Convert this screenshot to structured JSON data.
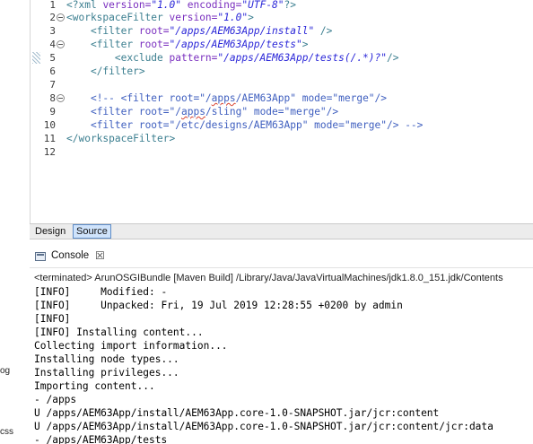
{
  "left_strip": {
    "fragment_1": "og",
    "fragment_2": "css"
  },
  "editor": {
    "lines": [
      {
        "num": "1"
      },
      {
        "num": "2"
      },
      {
        "num": "3"
      },
      {
        "num": "4"
      },
      {
        "num": "5"
      },
      {
        "num": "6"
      },
      {
        "num": "7"
      },
      {
        "num": "8"
      },
      {
        "num": "9"
      },
      {
        "num": "10"
      },
      {
        "num": "11"
      },
      {
        "num": "12"
      }
    ],
    "l1": {
      "a": "<?",
      "b": "xml",
      "c": " version=",
      "d": "\"1.0\"",
      "e": " encoding=",
      "f": "\"UTF-8\"",
      "g": "?>"
    },
    "l2": {
      "a": "<workspaceFilter",
      "b": " version=",
      "c": "\"1.0\"",
      "d": ">"
    },
    "l3": {
      "indent": "    ",
      "a": "<filter",
      "b": " root=",
      "c": "\"/apps/AEM63App/install\"",
      "d": " />"
    },
    "l4": {
      "indent": "    ",
      "a": "<filter",
      "b": " root=",
      "c": "\"/apps/AEM63App/tests\"",
      "d": ">"
    },
    "l5": {
      "indent": "        ",
      "a": "<exclude",
      "b": " pattern=",
      "c": "\"/apps/AEM63App/tests(/.*)?\"",
      "d": "/>"
    },
    "l6": {
      "indent": "    ",
      "a": "</filter>"
    },
    "l8": {
      "indent": "    ",
      "a": "<!-- <filter root=\"/",
      "b": "apps",
      "c": "/AEM63App\" mode=\"merge\"/>"
    },
    "l9": {
      "indent": "    ",
      "a": "<filter root=\"/",
      "b": "apps",
      "c": "/sling\" mode=\"merge\"/>"
    },
    "l10": {
      "indent": "    ",
      "a": "<filter root=\"/etc/designs/AEM63App\" mode=\"merge\"/> -->"
    },
    "l11": {
      "a": "</workspaceFilter>"
    }
  },
  "tabs": {
    "design": "Design",
    "source": "Source"
  },
  "console": {
    "title": "Console",
    "close": "☒",
    "terminated": "<terminated> ArunOSGIBundle [Maven Build] /Library/Java/JavaVirtualMachines/jdk1.8.0_151.jdk/Contents",
    "lines": [
      "[INFO]     Modified: -",
      "[INFO]     Unpacked: Fri, 19 Jul 2019 12:28:55 +0200 by admin",
      "[INFO]",
      "[INFO] Installing content...",
      "Collecting import information...",
      "Installing node types...",
      "Installing privileges...",
      "Importing content...",
      "- /apps",
      "U /apps/AEM63App/install/AEM63App.core-1.0-SNAPSHOT.jar/jcr:content",
      "U /apps/AEM63App/install/AEM63App.core-1.0-SNAPSHOT.jar/jcr:content/jcr:data",
      "- /apps/AEM63App/tests"
    ]
  }
}
